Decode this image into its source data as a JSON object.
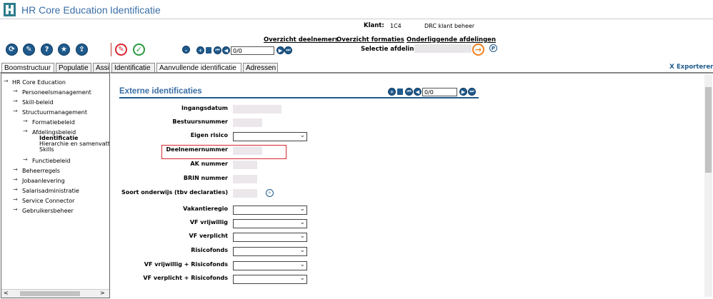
{
  "header": {
    "app_title": "HR Core Education",
    "page_title": "Identificatie"
  },
  "client": {
    "label": "Klant:",
    "code": "1C4",
    "name": "DRC klant beheer"
  },
  "links": {
    "participants": "Overzicht deelnemers",
    "formations": "Overzicht formaties",
    "departments": "Onderliggende afdelingen"
  },
  "department_selection": {
    "label": "Selectie afdeling",
    "value": ""
  },
  "pager": {
    "value": "0/0"
  },
  "tabs": {
    "left": [
      {
        "label": "Boomstructuur",
        "active": true
      },
      {
        "label": "Populatie",
        "active": false
      },
      {
        "label": "Assi",
        "active": false
      }
    ],
    "right": [
      {
        "label": "Identificatie",
        "active": false
      },
      {
        "label": "Aanvullende identificatie",
        "active": true
      },
      {
        "label": "Adressen",
        "active": false
      }
    ]
  },
  "export": {
    "label": "Exporteren"
  },
  "tree": [
    {
      "label": "HR Core Education",
      "arrow": true,
      "level": 0
    },
    {
      "label": "Personeelsmanagement",
      "arrow": true,
      "level": 1
    },
    {
      "label": "Skill-beleid",
      "arrow": true,
      "level": 1
    },
    {
      "label": "Structuurmanagement",
      "arrow": true,
      "level": 1
    },
    {
      "label": "Formatiebeleid",
      "arrow": true,
      "level": 2
    },
    {
      "label": "Afdelingsbeleid",
      "arrow": true,
      "level": 2
    },
    {
      "label": "Identificatie",
      "arrow": false,
      "level": 3,
      "bold": true
    },
    {
      "label": "Hierarchie en samenvatting",
      "arrow": false,
      "level": 3
    },
    {
      "label": "Skills",
      "arrow": false,
      "level": 3
    },
    {
      "label": "Functiebeleid",
      "arrow": true,
      "level": 2
    },
    {
      "label": "Beheerregels",
      "arrow": true,
      "level": 1
    },
    {
      "label": "Jobaanlevering",
      "arrow": true,
      "level": 1
    },
    {
      "label": "Salarisadministratie",
      "arrow": true,
      "level": 1
    },
    {
      "label": "Service Connector",
      "arrow": true,
      "level": 1
    },
    {
      "label": "Gebruikersbeheer",
      "arrow": true,
      "level": 1
    }
  ],
  "section": {
    "title": "Externe identificaties"
  },
  "form": {
    "fields": [
      {
        "label": "Ingangsdatum",
        "type": "readonly"
      },
      {
        "label": "Bestuursnummer",
        "type": "readonly"
      },
      {
        "label": "Eigen risico",
        "type": "select"
      },
      {
        "label": "Deelnemernummer",
        "type": "readonly",
        "highlighted": true
      },
      {
        "label": "AK nummer",
        "type": "readonly"
      },
      {
        "label": "BRIN nummer",
        "type": "readonly"
      },
      {
        "label": "Soort onderwijs (tbv declaraties)",
        "type": "readonly",
        "lookup": true
      },
      {
        "label": "Vakantieregio",
        "type": "select"
      },
      {
        "label": "VF vrijwillig",
        "type": "select"
      },
      {
        "label": "VF verplicht",
        "type": "select"
      },
      {
        "label": "Risicofonds",
        "type": "select"
      },
      {
        "label": "VF vrijwillig + Risicofonds",
        "type": "select"
      },
      {
        "label": "VF verplicht + Risicofonds",
        "type": "select"
      }
    ]
  },
  "colors": {
    "brand_blue": "#3a6ea5",
    "highlight_red": "#d9282f",
    "section_underline": "#1e5a8c",
    "go_arrow": "#f08020"
  }
}
